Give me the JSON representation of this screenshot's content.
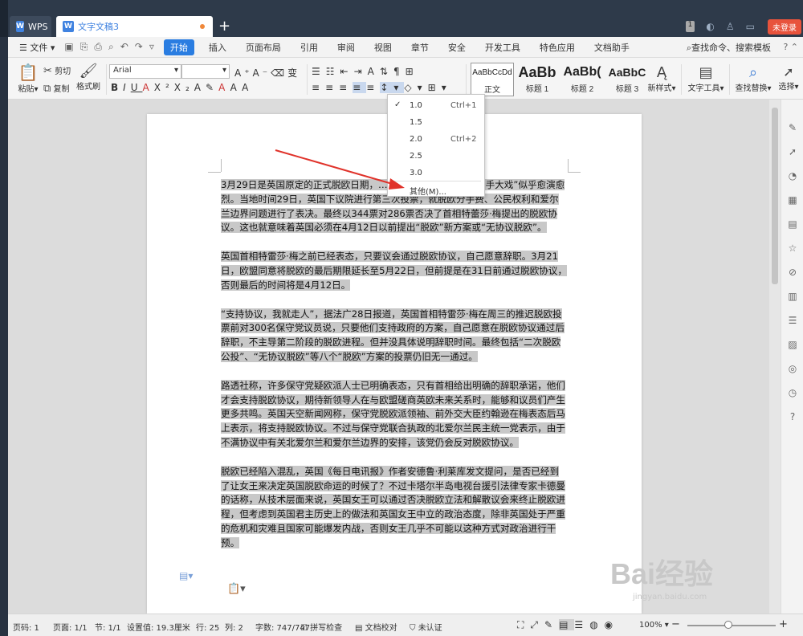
{
  "window": {
    "app_tab": "WPS",
    "doc_tab": "文字文稿3",
    "badge": "1",
    "login": "未登录"
  },
  "menu": {
    "file": "文件",
    "items": [
      "开始",
      "插入",
      "页面布局",
      "引用",
      "审阅",
      "视图",
      "章节",
      "安全",
      "开发工具",
      "特色应用",
      "文档助手"
    ],
    "search": "查找命令、搜索模板",
    "help": "?"
  },
  "ribbon": {
    "paste": "粘贴",
    "cut": "剪切",
    "copy": "复制",
    "format_painter": "格式刷",
    "font_name": "Arial",
    "font_size": "",
    "styles": [
      {
        "sample": "AaBbCcDd",
        "label": "正文"
      },
      {
        "sample": "AaBb",
        "label": "标题 1"
      },
      {
        "sample": "AaBb(",
        "label": "标题 2"
      },
      {
        "sample": "AaBbC",
        "label": "标题 3"
      }
    ],
    "new_style": "新样式",
    "text_tools": "文字工具",
    "find_replace": "查找替换",
    "select": "选择"
  },
  "line_spacing_menu": {
    "items": [
      {
        "value": "1.0",
        "shortcut": "Ctrl+1",
        "checked": true
      },
      {
        "value": "1.5",
        "shortcut": "",
        "checked": false
      },
      {
        "value": "2.0",
        "shortcut": "Ctrl+2",
        "checked": false
      },
      {
        "value": "2.5",
        "shortcut": "",
        "checked": false
      },
      {
        "value": "3.0",
        "shortcut": "",
        "checked": false
      },
      {
        "value": "其他(M)...",
        "shortcut": "",
        "checked": false
      }
    ]
  },
  "document": {
    "paragraphs": [
      "3月29日是英国原定的正式脱欧日期，……正式推迟，但这出“分手大戏”似乎愈演愈烈。当地时间29日，英国下议院进行第三次投票，就脱欧分手费、公民权利和爱尔兰边界问题进行了表决。最终以344票对286票否决了首相特蕾莎·梅提出的脱欧协议。这也就意味着英国必须在4月12日以前提出“脱欧”新方案或“无协议脱欧”。",
      "英国首相特雷莎·梅之前已经表态，只要议会通过脱欧协议，自己愿意辞职。3月21日，欧盟同意将脱欧的最后期限延长至5月22日，但前提是在31日前通过脱欧协议，否则最后的时间将是4月12日。",
      "“支持协议，我就走人”，据法广28日报道，英国首相特雷莎·梅在周三的推迟脱欧投票前对300名保守党议员说，只要他们支持政府的方案，自己愿意在脱欧协议通过后辞职，不主导第二阶段的脱欧进程。但并没具体说明辞职时间。最终包括“二次脱欧公投”、“无协议脱欧”等八个“脱欧”方案的投票仍旧无一通过。",
      "路透社称，许多保守党疑欧派人士已明确表态，只有首相给出明确的辞职承诺，他们才会支持脱欧协议，期待新领导人在与欧盟磋商英欧未来关系时，能够和议员们产生更多共鸣。英国天空新闻网称，保守党脱欧派领袖、前外交大臣约翰逊在梅表态后马上表示，将支持脱欧协议。不过与保守党联合执政的北爱尔兰民主统一党表示，由于不满协议中有关北爱尔兰和爱尔兰边界的安排，该党仍会反对脱欧协议。",
      "脱欧已经陷入混乱，英国《每日电讯报》作者安德鲁·利莱库发文提问，是否已经到了让女王来决定英国脱欧命运的时候了？不过卡塔尔半岛电视台援引法律专家卡德曼的话称，从技术层面来说，英国女王可以通过否决脱欧立法和解散议会来终止脱欧进程，但考虑到英国君主历史上的做法和英国女王中立的政治态度，除非英国处于严重的危机和灾难且国家可能爆发内战，否则女王几乎不可能以这种方式对政治进行干预。"
    ]
  },
  "status": {
    "page_no": "页码: 1",
    "pages": "页面: 1/1",
    "section": "节: 1/1",
    "setting": "设置值: 19.3厘米",
    "row": "行: 25",
    "col": "列: 2",
    "words": "字数: 747/747",
    "spell": "拼写检查",
    "proof": "文档校对",
    "cert": "未认证",
    "zoom": "100%"
  },
  "watermark": {
    "brand": "Bai经验",
    "url": "jingyan.baidu.com"
  }
}
